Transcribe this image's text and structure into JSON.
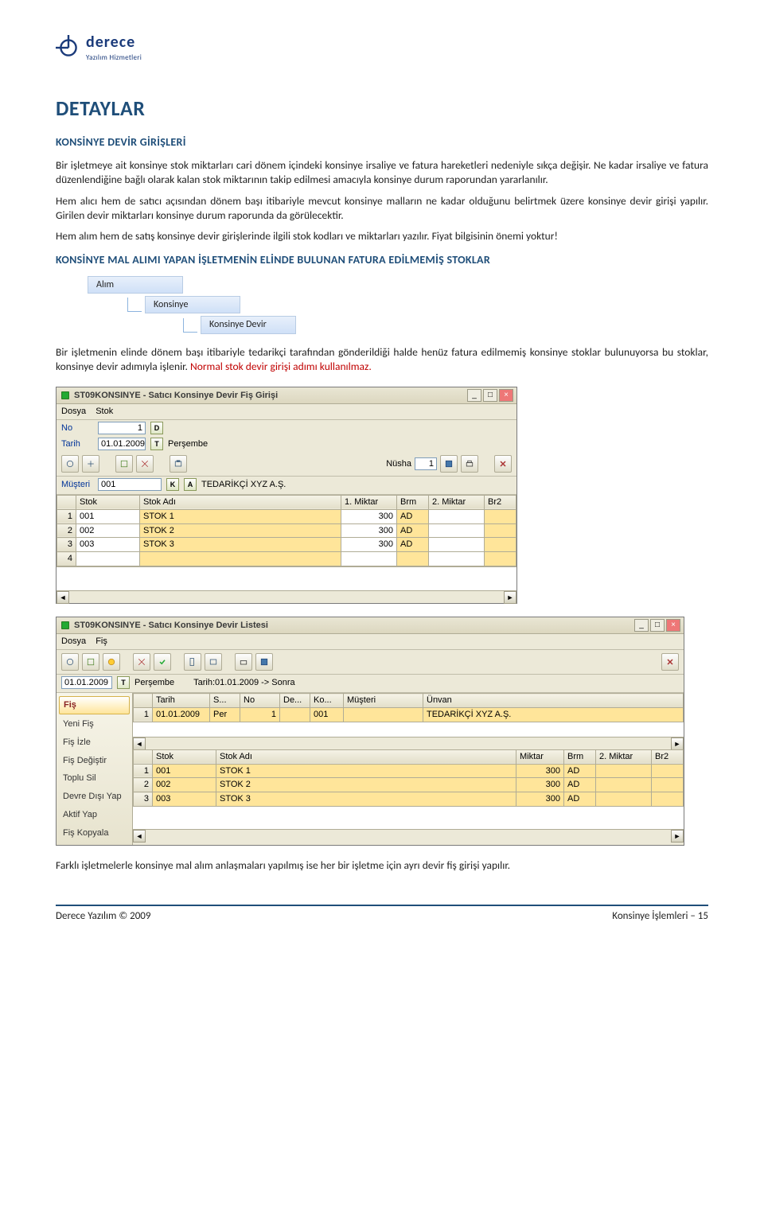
{
  "logo": {
    "brand": "derece",
    "sub": "Yazılım Hizmetleri"
  },
  "title": "DETAYLAR",
  "section1": {
    "heading": "KONSİNYE DEVİR GİRİŞLERİ",
    "p1": "Bir işletmeye ait konsinye stok miktarları cari dönem içindeki konsinye irsaliye ve fatura hareketleri nedeniyle sıkça değişir. Ne kadar irsaliye ve fatura düzenlendiğine bağlı olarak kalan stok miktarının takip edilmesi amacıyla konsinye durum raporundan yararlanılır.",
    "p2": "Hem alıcı hem de satıcı açısından dönem başı itibariyle mevcut konsinye malların ne kadar olduğunu belirtmek üzere konsinye devir girişi yapılır. Girilen devir miktarları konsinye durum raporunda da görülecektir.",
    "p3": "Hem alım hem de satış konsinye devir girişlerinde ilgili stok kodları ve miktarları yazılır. Fiyat bilgisinin önemi yoktur!"
  },
  "section2": {
    "heading": "KONSİNYE MAL ALIMI YAPAN İŞLETMENİN ELİNDE BULUNAN FATURA EDİLMEMİŞ STOKLAR",
    "tree": [
      "Alım",
      "Konsinye",
      "Konsinye Devir"
    ],
    "p1a": "Bir işletmenin elinde dönem başı itibariyle tedarikçi tarafından gönderildiği halde henüz fatura edilmemiş konsinye stoklar bulunuyorsa bu stoklar, konsinye devir adımıyla işlenir. ",
    "p1b": "Normal stok devir girişi adımı kullanılmaz."
  },
  "win1": {
    "title": "ST09KONSINYE - Satıcı Konsinye Devir Fiş Girişi",
    "menu": [
      "Dosya",
      "Stok"
    ],
    "no_label": "No",
    "no_value": "1",
    "no_btn": "D",
    "tarih_label": "Tarih",
    "tarih_value": "01.01.2009",
    "tarih_btn": "T",
    "day": "Perşembe",
    "nusha_label": "Nüsha",
    "nusha_value": "1",
    "musteri_label": "Müşteri",
    "musteri_value": "001",
    "musteri_btns": [
      "K",
      "A"
    ],
    "musteri_name": "TEDARİKÇİ XYZ A.Ş.",
    "cols": [
      "Stok",
      "Stok Adı",
      "1. Miktar",
      "Brm",
      "2. Miktar",
      "Br2"
    ],
    "rows": [
      {
        "n": "1",
        "stok": "001",
        "ad": "STOK 1",
        "m1": "300",
        "brm": "AD",
        "m2": "",
        "br2": ""
      },
      {
        "n": "2",
        "stok": "002",
        "ad": "STOK 2",
        "m1": "300",
        "brm": "AD",
        "m2": "",
        "br2": ""
      },
      {
        "n": "3",
        "stok": "003",
        "ad": "STOK 3",
        "m1": "300",
        "brm": "AD",
        "m2": "",
        "br2": ""
      },
      {
        "n": "4",
        "stok": "",
        "ad": "",
        "m1": "",
        "brm": "",
        "m2": "",
        "br2": ""
      }
    ]
  },
  "win2": {
    "title": "ST09KONSINYE - Satıcı Konsinye Devir Listesi",
    "menu": [
      "Dosya",
      "Fiş"
    ],
    "filter_date": "01.01.2009",
    "filter_btn": "T",
    "filter_day": "Perşembe",
    "filter_range": "Tarih:01.01.2009 -> Sonra",
    "side_items": [
      "Fiş",
      "Yeni Fiş",
      "Fiş İzle",
      "Fiş Değiştir",
      "Toplu Sil",
      "Devre Dışı Yap",
      "Aktif Yap",
      "Fiş Kopyala"
    ],
    "top_cols": [
      "Tarih",
      "S...",
      "No",
      "De...",
      "Ko...",
      "Müşteri",
      "Ünvan"
    ],
    "top_rows": [
      {
        "n": "1",
        "tarih": "01.01.2009",
        "gun": "Per",
        "no": "1",
        "de": "",
        "ko": "001",
        "mus": "",
        "unvan": "TEDARİKÇİ XYZ A.Ş."
      }
    ],
    "bot_cols": [
      "Stok",
      "Stok Adı",
      "Miktar",
      "Brm",
      "2. Miktar",
      "Br2"
    ],
    "bot_rows": [
      {
        "n": "1",
        "stok": "001",
        "ad": "STOK 1",
        "m1": "300",
        "brm": "AD",
        "m2": "",
        "br2": ""
      },
      {
        "n": "2",
        "stok": "002",
        "ad": "STOK 2",
        "m1": "300",
        "brm": "AD",
        "m2": "",
        "br2": ""
      },
      {
        "n": "3",
        "stok": "003",
        "ad": "STOK 3",
        "m1": "300",
        "brm": "AD",
        "m2": "",
        "br2": ""
      }
    ]
  },
  "closing": "Farklı işletmelerle konsinye mal alım anlaşmaları yapılmış ise her bir işletme için ayrı devir fiş girişi yapılır.",
  "footer": {
    "left": "Derece Yazılım © 2009",
    "right": "Konsinye İşlemleri – 15"
  }
}
